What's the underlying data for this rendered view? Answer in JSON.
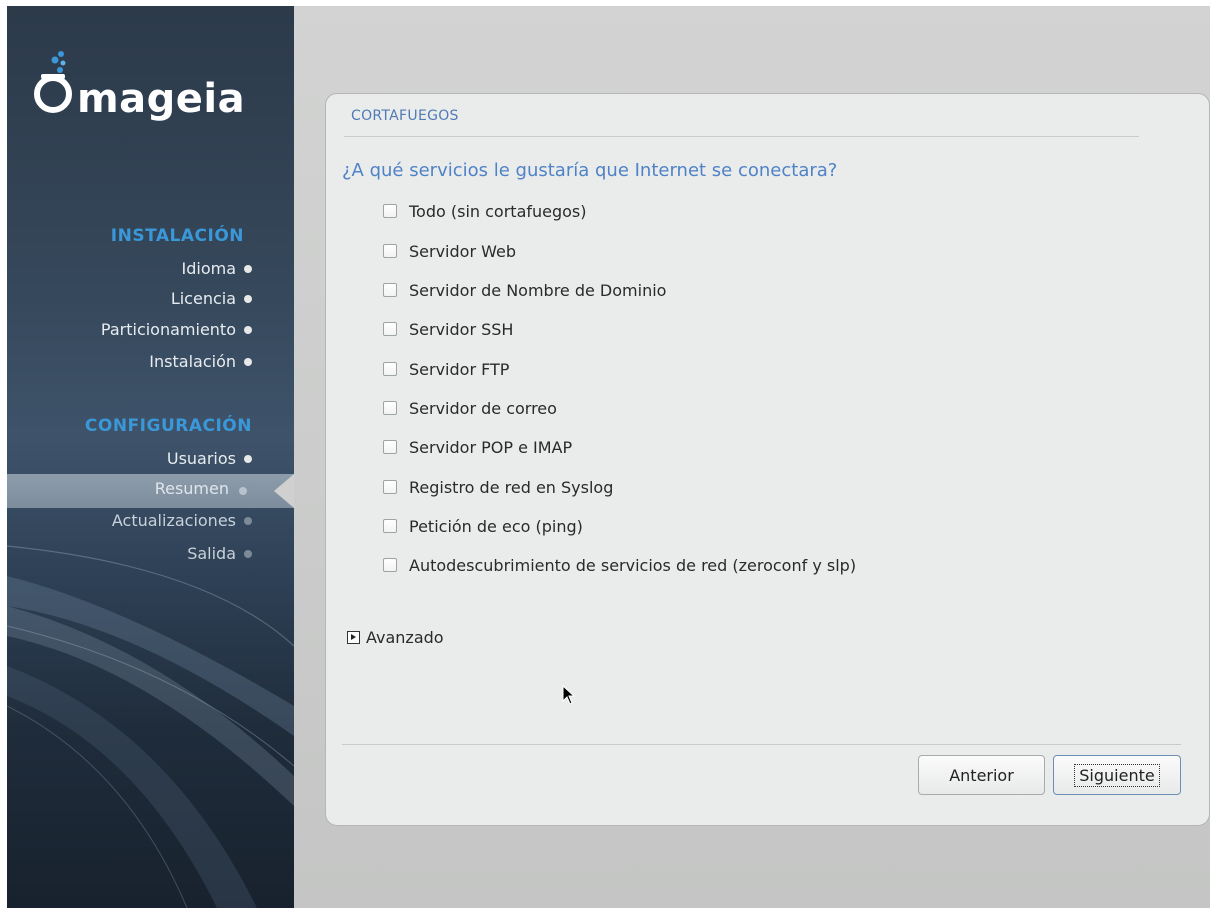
{
  "app": {
    "brand": "mageia"
  },
  "sidebar": {
    "install_section": {
      "title": "INSTALACIÓN",
      "items": [
        {
          "label": "Idioma",
          "state": "done"
        },
        {
          "label": "Licencia",
          "state": "done"
        },
        {
          "label": "Particionamiento",
          "state": "done"
        },
        {
          "label": "Instalación",
          "state": "done"
        }
      ]
    },
    "config_section": {
      "title": "CONFIGURACIÓN",
      "items": [
        {
          "label": "Usuarios",
          "state": "done"
        },
        {
          "label": "Resumen",
          "state": "current"
        },
        {
          "label": "Actualizaciones",
          "state": "pending"
        },
        {
          "label": "Salida",
          "state": "pending"
        }
      ]
    }
  },
  "panel": {
    "title": "CORTAFUEGOS",
    "question": "¿A qué servicios le gustaría que Internet se conectara?",
    "options": [
      {
        "label": "Todo (sin cortafuegos)",
        "checked": false
      },
      {
        "label": "Servidor Web",
        "checked": false
      },
      {
        "label": "Servidor de Nombre de Dominio",
        "checked": false
      },
      {
        "label": "Servidor SSH",
        "checked": false
      },
      {
        "label": "Servidor FTP",
        "checked": false
      },
      {
        "label": "Servidor de correo",
        "checked": false
      },
      {
        "label": "Servidor POP e IMAP",
        "checked": false
      },
      {
        "label": "Registro de red en Syslog",
        "checked": false
      },
      {
        "label": "Petición de eco (ping)",
        "checked": false
      },
      {
        "label": "Autodescubrimiento de servicios de red (zeroconf y slp)",
        "checked": false
      }
    ],
    "advanced_label": "Avanzado",
    "buttons": {
      "previous": "Anterior",
      "next": "Siguiente"
    }
  },
  "colors": {
    "accent": "#4f82c7",
    "section_title": "#3a98d9",
    "sidebar_dark": "#1f2c3b"
  },
  "icons": [
    "mageia-logo-icon",
    "status-dot-icon",
    "expander-arrow-icon",
    "mouse-pointer-icon"
  ]
}
